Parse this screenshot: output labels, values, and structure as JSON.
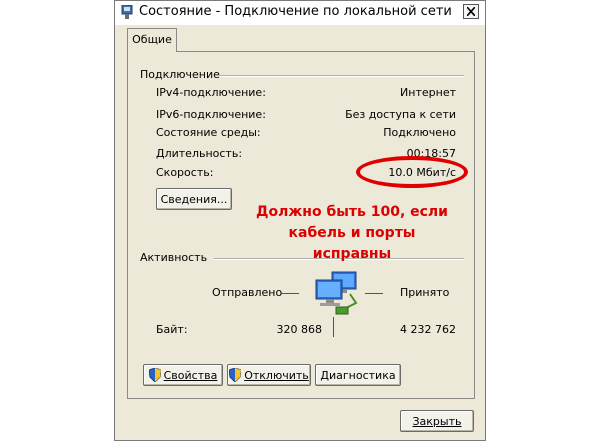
{
  "window": {
    "title": "Состояние - Подключение по локальной сети"
  },
  "tabs": [
    {
      "label": "Общие"
    }
  ],
  "connection": {
    "section_label": "Подключение",
    "rows": [
      {
        "label": "IPv4-подключение:",
        "value": "Интернет"
      },
      {
        "label": "IPv6-подключение:",
        "value": "Без доступа к сети"
      },
      {
        "label": "Состояние среды:",
        "value": "Подключено"
      },
      {
        "label": "Длительность:",
        "value": "00:18:57"
      },
      {
        "label": "Скорость:",
        "value": "10.0 Мбит/с"
      }
    ],
    "details_button": "Сведения..."
  },
  "activity": {
    "section_label": "Активность",
    "sent_label": "Отправлено",
    "received_label": "Принято",
    "bytes_label": "Байт:",
    "bytes_sent": "320 868",
    "bytes_received": "4 232 762"
  },
  "buttons": {
    "properties": "Свойства",
    "disable": "Отключить",
    "diagnose": "Диагностика",
    "close": "Закрыть"
  },
  "annotation": {
    "line1": "Должно быть 100, если",
    "line2": "кабель и порты исправны",
    "color": "#dd0000"
  },
  "icons": [
    "network-adapter-icon",
    "close-icon",
    "shield-icon",
    "network-computers-icon"
  ]
}
